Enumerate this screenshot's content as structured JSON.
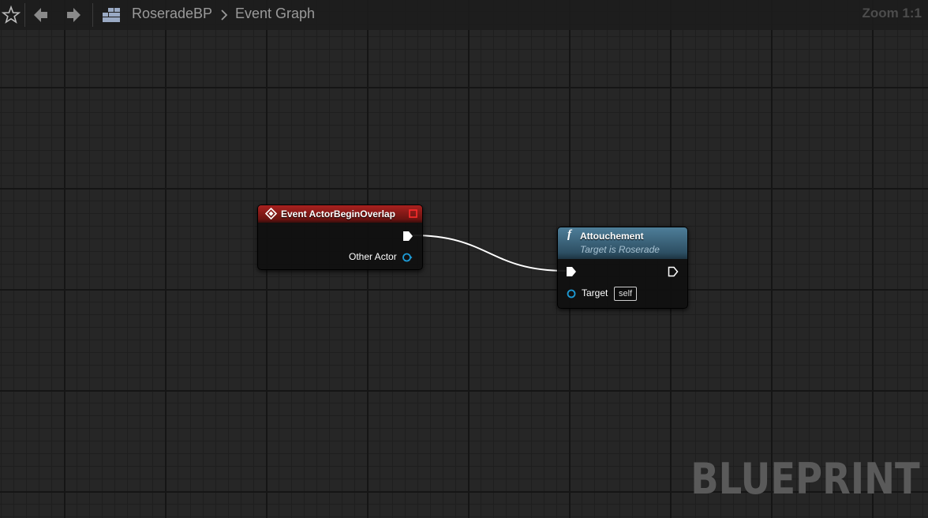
{
  "toolbar": {
    "icons": [
      "star-icon",
      "back-arrow-icon",
      "forward-arrow-icon",
      "blueprint-icon"
    ],
    "breadcrumb_root": "RoseradeBP",
    "breadcrumb_separator_icon": "chevron-right-icon",
    "breadcrumb_current": "Event Graph",
    "zoom": "Zoom 1:1"
  },
  "nodes": {
    "event": {
      "icon": "event-diamond-icon",
      "title": "Event ActorBeginOverlap",
      "output_pins": [
        "Exec",
        "Other Actor"
      ],
      "other_actor_label": "Other Actor",
      "header_color": "#a8211f"
    },
    "function": {
      "icon": "function-f-icon",
      "title": "Attouchement",
      "subtitle": "Target is Roserade",
      "target_label": "Target",
      "target_default": "self",
      "header_color": "#4e7e99"
    }
  },
  "colors": {
    "object_pin": "#1d9bd6",
    "exec_pin": "#ffffff",
    "wire": "#ffffff"
  },
  "watermark": "BLUEPRINT"
}
